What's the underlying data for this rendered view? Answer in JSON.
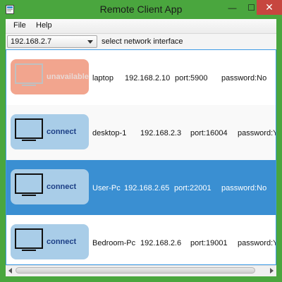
{
  "window": {
    "title": "Remote Client App",
    "minimize_glyph": "—",
    "maximize_glyph": "☐",
    "close_glyph": "✕",
    "accent_color": "#4aa63e"
  },
  "menu": {
    "items": [
      {
        "label": "File"
      },
      {
        "label": "Help"
      }
    ]
  },
  "toolbar": {
    "interface_value": "192.168.2.7",
    "interface_hint": "select network interface"
  },
  "clients": [
    {
      "button_label": "unavailable",
      "status": "unavailable",
      "name": "laptop",
      "ip": "192.168.2.10",
      "port": "port:5900",
      "password": "password:No",
      "selected": false
    },
    {
      "button_label": "connect",
      "status": "available",
      "name": "desktop-1",
      "ip": "192.168.2.3",
      "port": "port:16004",
      "password": "password:Yes",
      "selected": false
    },
    {
      "button_label": "connect",
      "status": "available",
      "name": "User-Pc",
      "ip": "192.168.2.65",
      "port": "port:22001",
      "password": "password:No",
      "selected": true
    },
    {
      "button_label": "connect",
      "status": "available",
      "name": "Bedroom-Pc",
      "ip": "192.168.2.6",
      "port": "port:19001",
      "password": "password:Yes",
      "selected": false
    }
  ],
  "colors": {
    "selected_row": "#3a8fd2",
    "connect_button": "#a9cde8",
    "unavailable_button": "#f2a58e",
    "close_button": "#c7463f"
  }
}
